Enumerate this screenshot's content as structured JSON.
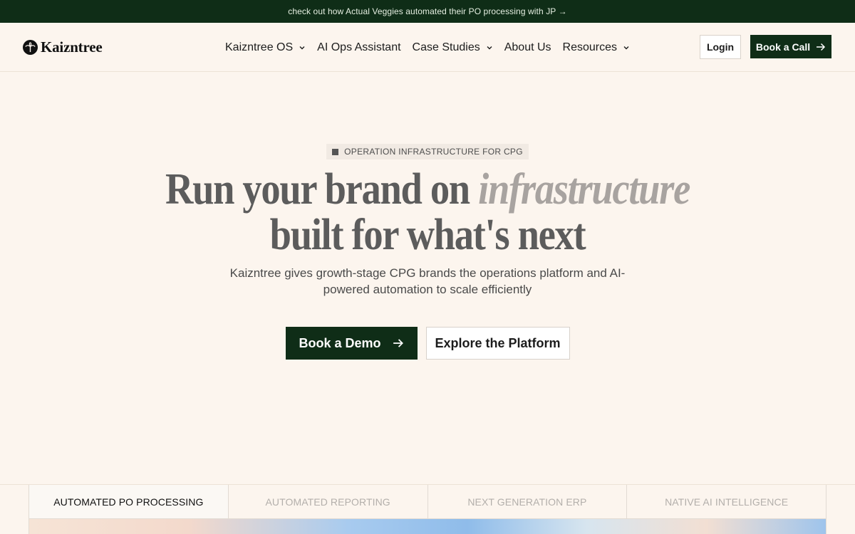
{
  "announcement": {
    "text": "check out how Actual Veggies automated their PO processing with JP →"
  },
  "brand": {
    "name": "Kaizntree",
    "logo_icon": "palm-tree-icon"
  },
  "nav": {
    "items": [
      {
        "label": "Kaizntree OS",
        "dropdown": true
      },
      {
        "label": "AI Ops Assistant",
        "dropdown": false
      },
      {
        "label": "Case Studies",
        "dropdown": true
      },
      {
        "label": "About Us",
        "dropdown": false
      },
      {
        "label": "Resources",
        "dropdown": true
      }
    ],
    "login_label": "Login",
    "call_label": "Book a Call"
  },
  "hero": {
    "eyebrow": "OPERATION INFRASTRUCTURE FOR CPG",
    "headline_part1": "Run your brand on ",
    "headline_emphasis": "infrastructure",
    "headline_line2": "built for what's next",
    "subhead": "Kaizntree gives growth-stage CPG brands the operations platform and AI-powered automation to scale efficiently",
    "primary_cta": "Book a Demo",
    "secondary_cta": "Explore the Platform"
  },
  "feature_tabs": {
    "active_index": 0,
    "items": [
      "AUTOMATED PO PROCESSING",
      "AUTOMATED REPORTING",
      "NEXT GENERATION ERP",
      "NATIVE AI INTELLIGENCE"
    ]
  },
  "colors": {
    "brand_green": "#0f2d17",
    "page_background": "#fcf5ee",
    "headline_gray": "#5c5c5c",
    "emphasis_gray": "#a8a3a0"
  }
}
